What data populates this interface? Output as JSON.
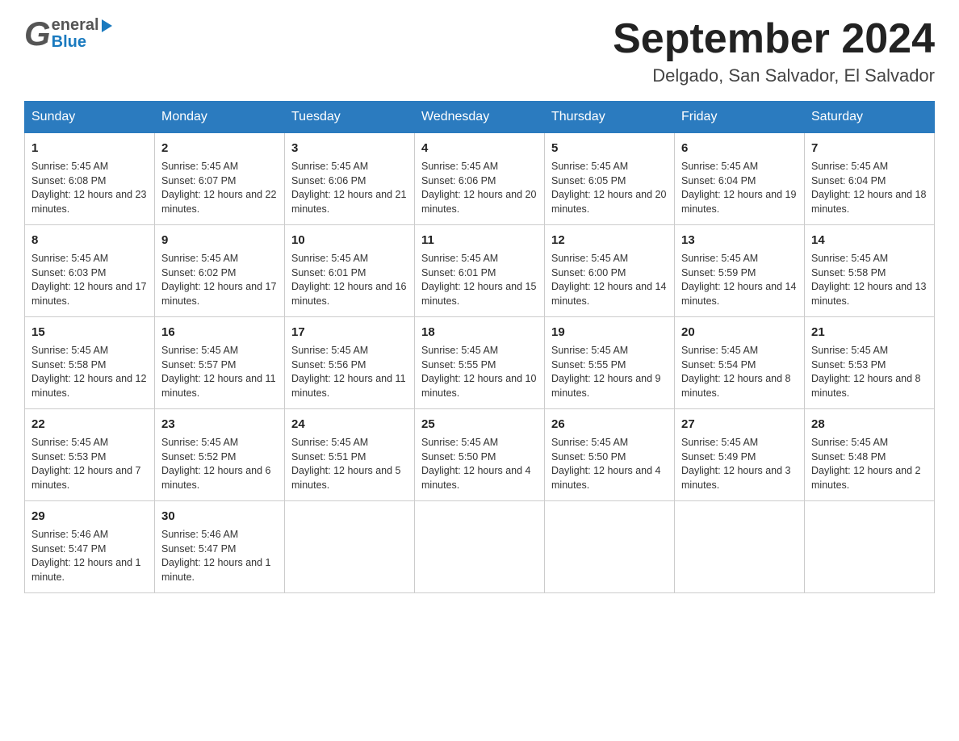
{
  "header": {
    "month_year": "September 2024",
    "location": "Delgado, San Salvador, El Salvador",
    "logo_general": "General",
    "logo_blue": "Blue"
  },
  "days_of_week": [
    "Sunday",
    "Monday",
    "Tuesday",
    "Wednesday",
    "Thursday",
    "Friday",
    "Saturday"
  ],
  "weeks": [
    [
      {
        "day": "1",
        "sunrise": "5:45 AM",
        "sunset": "6:08 PM",
        "daylight": "12 hours and 23 minutes."
      },
      {
        "day": "2",
        "sunrise": "5:45 AM",
        "sunset": "6:07 PM",
        "daylight": "12 hours and 22 minutes."
      },
      {
        "day": "3",
        "sunrise": "5:45 AM",
        "sunset": "6:06 PM",
        "daylight": "12 hours and 21 minutes."
      },
      {
        "day": "4",
        "sunrise": "5:45 AM",
        "sunset": "6:06 PM",
        "daylight": "12 hours and 20 minutes."
      },
      {
        "day": "5",
        "sunrise": "5:45 AM",
        "sunset": "6:05 PM",
        "daylight": "12 hours and 20 minutes."
      },
      {
        "day": "6",
        "sunrise": "5:45 AM",
        "sunset": "6:04 PM",
        "daylight": "12 hours and 19 minutes."
      },
      {
        "day": "7",
        "sunrise": "5:45 AM",
        "sunset": "6:04 PM",
        "daylight": "12 hours and 18 minutes."
      }
    ],
    [
      {
        "day": "8",
        "sunrise": "5:45 AM",
        "sunset": "6:03 PM",
        "daylight": "12 hours and 17 minutes."
      },
      {
        "day": "9",
        "sunrise": "5:45 AM",
        "sunset": "6:02 PM",
        "daylight": "12 hours and 17 minutes."
      },
      {
        "day": "10",
        "sunrise": "5:45 AM",
        "sunset": "6:01 PM",
        "daylight": "12 hours and 16 minutes."
      },
      {
        "day": "11",
        "sunrise": "5:45 AM",
        "sunset": "6:01 PM",
        "daylight": "12 hours and 15 minutes."
      },
      {
        "day": "12",
        "sunrise": "5:45 AM",
        "sunset": "6:00 PM",
        "daylight": "12 hours and 14 minutes."
      },
      {
        "day": "13",
        "sunrise": "5:45 AM",
        "sunset": "5:59 PM",
        "daylight": "12 hours and 14 minutes."
      },
      {
        "day": "14",
        "sunrise": "5:45 AM",
        "sunset": "5:58 PM",
        "daylight": "12 hours and 13 minutes."
      }
    ],
    [
      {
        "day": "15",
        "sunrise": "5:45 AM",
        "sunset": "5:58 PM",
        "daylight": "12 hours and 12 minutes."
      },
      {
        "day": "16",
        "sunrise": "5:45 AM",
        "sunset": "5:57 PM",
        "daylight": "12 hours and 11 minutes."
      },
      {
        "day": "17",
        "sunrise": "5:45 AM",
        "sunset": "5:56 PM",
        "daylight": "12 hours and 11 minutes."
      },
      {
        "day": "18",
        "sunrise": "5:45 AM",
        "sunset": "5:55 PM",
        "daylight": "12 hours and 10 minutes."
      },
      {
        "day": "19",
        "sunrise": "5:45 AM",
        "sunset": "5:55 PM",
        "daylight": "12 hours and 9 minutes."
      },
      {
        "day": "20",
        "sunrise": "5:45 AM",
        "sunset": "5:54 PM",
        "daylight": "12 hours and 8 minutes."
      },
      {
        "day": "21",
        "sunrise": "5:45 AM",
        "sunset": "5:53 PM",
        "daylight": "12 hours and 8 minutes."
      }
    ],
    [
      {
        "day": "22",
        "sunrise": "5:45 AM",
        "sunset": "5:53 PM",
        "daylight": "12 hours and 7 minutes."
      },
      {
        "day": "23",
        "sunrise": "5:45 AM",
        "sunset": "5:52 PM",
        "daylight": "12 hours and 6 minutes."
      },
      {
        "day": "24",
        "sunrise": "5:45 AM",
        "sunset": "5:51 PM",
        "daylight": "12 hours and 5 minutes."
      },
      {
        "day": "25",
        "sunrise": "5:45 AM",
        "sunset": "5:50 PM",
        "daylight": "12 hours and 4 minutes."
      },
      {
        "day": "26",
        "sunrise": "5:45 AM",
        "sunset": "5:50 PM",
        "daylight": "12 hours and 4 minutes."
      },
      {
        "day": "27",
        "sunrise": "5:45 AM",
        "sunset": "5:49 PM",
        "daylight": "12 hours and 3 minutes."
      },
      {
        "day": "28",
        "sunrise": "5:45 AM",
        "sunset": "5:48 PM",
        "daylight": "12 hours and 2 minutes."
      }
    ],
    [
      {
        "day": "29",
        "sunrise": "5:46 AM",
        "sunset": "5:47 PM",
        "daylight": "12 hours and 1 minute."
      },
      {
        "day": "30",
        "sunrise": "5:46 AM",
        "sunset": "5:47 PM",
        "daylight": "12 hours and 1 minute."
      },
      null,
      null,
      null,
      null,
      null
    ]
  ]
}
